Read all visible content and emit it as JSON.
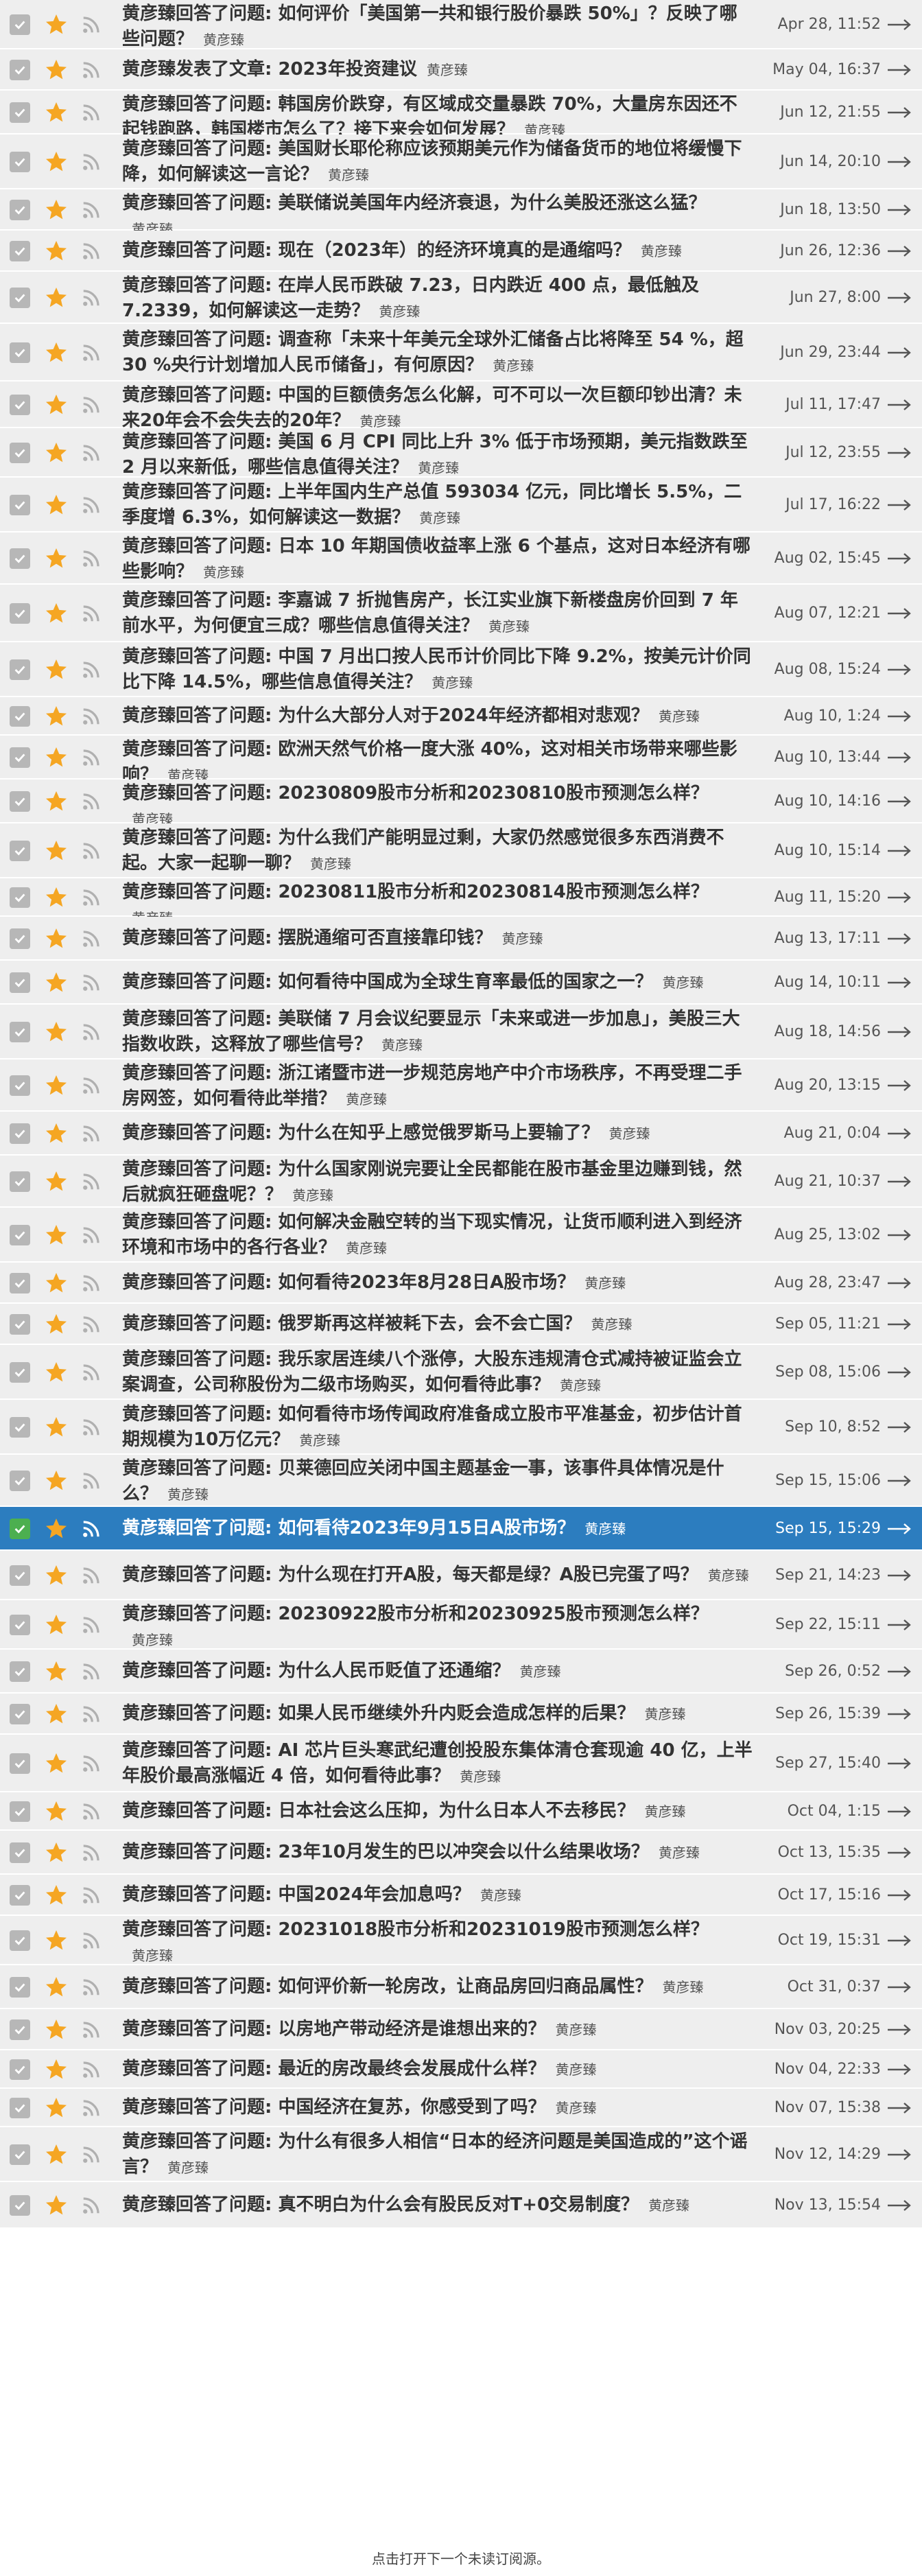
{
  "colors": {
    "row_bg": "#eeeeee",
    "selected_row_bg": "#2c7dbf",
    "star": "#f5a623",
    "checkbox": "#b7b7b7",
    "checkbox_selected": "#4caf50"
  },
  "icons": [
    "checkbox-checked-icon",
    "star-icon",
    "rss-feed-icon",
    "arrow-right-icon"
  ],
  "items": [
    {
      "title": "黄彦臻回答了问题: 如何评价「美国第一共和银行股价暴跌 50%」？反映了哪些问题？",
      "author": "黄彦臻",
      "date": "Apr 28, 11:52"
    },
    {
      "title": "黄彦臻发表了文章: 2023年投资建议",
      "author": "黄彦臻",
      "date": "May 04, 16:37"
    },
    {
      "title": "黄彦臻回答了问题: 韩国房价跌穿，有区域成交量暴跌 70%，大量房东因还不起钱跑路，韩国楼市怎么了？接下来会如何发展？",
      "author": "黄彦臻",
      "date": "Jun 12, 21:55"
    },
    {
      "title": "黄彦臻回答了问题: 美国财长耶伦称应该预期美元作为储备货币的地位将缓慢下降，如何解读这一言论？",
      "author": "黄彦臻",
      "date": "Jun 14, 20:10"
    },
    {
      "title": "黄彦臻回答了问题: 美联储说美国年内经济衰退，为什么美股还涨这么猛？",
      "author": "黄彦臻",
      "date": "Jun 18, 13:50"
    },
    {
      "title": "黄彦臻回答了问题: 现在（2023年）的经济环境真的是通缩吗？",
      "author": "黄彦臻",
      "date": "Jun 26, 12:36"
    },
    {
      "title": "黄彦臻回答了问题: 在岸人民币跌破 7.23，日内跌近 400 点，最低触及 7.2339，如何解读这一走势？",
      "author": "黄彦臻",
      "date": "Jun 27, 8:00"
    },
    {
      "title": "黄彦臻回答了问题: 调查称「未来十年美元全球外汇储备占比将降至 54 %，超 30 %央行计划增加人民币储备」，有何原因？",
      "author": "黄彦臻",
      "date": "Jun 29, 23:44"
    },
    {
      "title": "黄彦臻回答了问题: 中国的巨额债务怎么化解，可不可以一次巨额印钞出清？未来20年会不会失去的20年？",
      "author": "黄彦臻",
      "date": "Jul 11, 17:47"
    },
    {
      "title": "黄彦臻回答了问题: 美国 6 月 CPI 同比上升 3% 低于市场预期，美元指数跌至 2 月以来新低，哪些信息值得关注？",
      "author": "黄彦臻",
      "date": "Jul 12, 23:55"
    },
    {
      "title": "黄彦臻回答了问题: 上半年国内生产总值 593034 亿元，同比增长 5.5%，二季度增 6.3%，如何解读这一数据？",
      "author": "黄彦臻",
      "date": "Jul 17, 16:22"
    },
    {
      "title": "黄彦臻回答了问题: 日本 10 年期国债收益率上涨 6 个基点，这对日本经济有哪些影响？",
      "author": "黄彦臻",
      "date": "Aug 02, 15:45"
    },
    {
      "title": "黄彦臻回答了问题: 李嘉诚 7 折抛售房产，长江实业旗下新楼盘房价回到 7 年前水平，为何便宜三成？哪些信息值得关注？",
      "author": "黄彦臻",
      "date": "Aug 07, 12:21"
    },
    {
      "title": "黄彦臻回答了问题: 中国 7 月出口按人民币计价同比下降 9.2%，按美元计价同比下降 14.5%，哪些信息值得关注？",
      "author": "黄彦臻",
      "date": "Aug 08, 15:24"
    },
    {
      "title": "黄彦臻回答了问题: 为什么大部分人对于2024年经济都相对悲观？",
      "author": "黄彦臻",
      "date": "Aug 10, 1:24"
    },
    {
      "title": "黄彦臻回答了问题: 欧洲天然气价格一度大涨 40%，这对相关市场带来哪些影响？",
      "author": "黄彦臻",
      "date": "Aug 10, 13:44"
    },
    {
      "title": "黄彦臻回答了问题: 20230809股市分析和20230810股市预测怎么样？",
      "author": "黄彦臻",
      "date": "Aug 10, 14:16"
    },
    {
      "title": "黄彦臻回答了问题: 为什么我们产能明显过剩，大家仍然感觉很多东西消费不起。大家一起聊一聊？",
      "author": "黄彦臻",
      "date": "Aug 10, 15:14"
    },
    {
      "title": "黄彦臻回答了问题: 20230811股市分析和20230814股市预测怎么样？",
      "author": "黄彦臻",
      "date": "Aug 11, 15:20"
    },
    {
      "title": "黄彦臻回答了问题: 摆脱通缩可否直接靠印钱？",
      "author": "黄彦臻",
      "date": "Aug 13, 17:11"
    },
    {
      "title": "黄彦臻回答了问题: 如何看待中国成为全球生育率最低的国家之一？",
      "author": "黄彦臻",
      "date": "Aug 14, 10:11"
    },
    {
      "title": "黄彦臻回答了问题: 美联储 7 月会议纪要显示「未来或进一步加息」，美股三大指数收跌，这释放了哪些信号？",
      "author": "黄彦臻",
      "date": "Aug 18, 14:56"
    },
    {
      "title": "黄彦臻回答了问题: 浙江诸暨市进一步规范房地产中介市场秩序，不再受理二手房网签，如何看待此举措？",
      "author": "黄彦臻",
      "date": "Aug 20, 13:15"
    },
    {
      "title": "黄彦臻回答了问题: 为什么在知乎上感觉俄罗斯马上要输了？",
      "author": "黄彦臻",
      "date": "Aug 21, 0:04"
    },
    {
      "title": "黄彦臻回答了问题: 为什么国家刚说完要让全民都能在股市基金里边赚到钱，然后就疯狂砸盘呢？？",
      "author": "黄彦臻",
      "date": "Aug 21, 10:37"
    },
    {
      "title": "黄彦臻回答了问题: 如何解决金融空转的当下现实情况，让货币顺利进入到经济环境和市场中的各行各业？",
      "author": "黄彦臻",
      "date": "Aug 25, 13:02"
    },
    {
      "title": "黄彦臻回答了问题: 如何看待2023年8月28日A股市场？",
      "author": "黄彦臻",
      "date": "Aug 28, 23:47"
    },
    {
      "title": "黄彦臻回答了问题: 俄罗斯再这样被耗下去，会不会亡国？",
      "author": "黄彦臻",
      "date": "Sep 05, 11:21"
    },
    {
      "title": "黄彦臻回答了问题: 我乐家居连续八个涨停，大股东违规清仓式减持被证监会立案调查，公司称股份为二级市场购买，如何看待此事？",
      "author": "黄彦臻",
      "date": "Sep 08, 15:06"
    },
    {
      "title": "黄彦臻回答了问题: 如何看待市场传闻政府准备成立股市平准基金，初步估计首期规模为10万亿元？",
      "author": "黄彦臻",
      "date": "Sep 10, 8:52"
    },
    {
      "title": "黄彦臻回答了问题: 贝莱德回应关闭中国主题基金一事，该事件具体情况是什么？",
      "author": "黄彦臻",
      "date": "Sep 15, 15:06"
    },
    {
      "title": "黄彦臻回答了问题: 如何看待2023年9月15日A股市场？",
      "author": "黄彦臻",
      "date": "Sep 15, 15:29",
      "selected": true
    },
    {
      "title": "黄彦臻回答了问题: 为什么现在打开A股，每天都是绿？A股已完蛋了吗？",
      "author": "黄彦臻",
      "date": "Sep 21, 14:23"
    },
    {
      "title": "黄彦臻回答了问题: 20230922股市分析和20230925股市预测怎么样？",
      "author": "黄彦臻",
      "date": "Sep 22, 15:11"
    },
    {
      "title": "黄彦臻回答了问题: 为什么人民币贬值了还通缩？",
      "author": "黄彦臻",
      "date": "Sep 26, 0:52"
    },
    {
      "title": "黄彦臻回答了问题: 如果人民币继续外升内贬会造成怎样的后果？",
      "author": "黄彦臻",
      "date": "Sep 26, 15:39"
    },
    {
      "title": "黄彦臻回答了问题: AI 芯片巨头寒武纪遭创投股东集体清仓套现逾 40 亿，上半年股价最高涨幅近 4 倍，如何看待此事？",
      "author": "黄彦臻",
      "date": "Sep 27, 15:40"
    },
    {
      "title": "黄彦臻回答了问题: 日本社会这么压抑，为什么日本人不去移民？",
      "author": "黄彦臻",
      "date": "Oct 04, 1:15"
    },
    {
      "title": "黄彦臻回答了问题: 23年10月发生的巴以冲突会以什么结果收场？",
      "author": "黄彦臻",
      "date": "Oct 13, 15:35"
    },
    {
      "title": "黄彦臻回答了问题: 中国2024年会加息吗？",
      "author": "黄彦臻",
      "date": "Oct 17, 15:16"
    },
    {
      "title": "黄彦臻回答了问题: 20231018股市分析和20231019股市预测怎么样？",
      "author": "黄彦臻",
      "date": "Oct 19, 15:31"
    },
    {
      "title": "黄彦臻回答了问题: 如何评价新一轮房改，让商品房回归商品属性？",
      "author": "黄彦臻",
      "date": "Oct 31, 0:37"
    },
    {
      "title": "黄彦臻回答了问题: 以房地产带动经济是谁想出来的？",
      "author": "黄彦臻",
      "date": "Nov 03, 20:25"
    },
    {
      "title": "黄彦臻回答了问题: 最近的房改最终会发展成什么样？",
      "author": "黄彦臻",
      "date": "Nov 04, 22:33"
    },
    {
      "title": "黄彦臻回答了问题: 中国经济在复苏，你感受到了吗？",
      "author": "黄彦臻",
      "date": "Nov 07, 15:38"
    },
    {
      "title": "黄彦臻回答了问题: 为什么有很多人相信“日本的经济问题是美国造成的”这个谣言？",
      "author": "黄彦臻",
      "date": "Nov 12, 14:29"
    },
    {
      "title": "黄彦臻回答了问题: 真不明白为什么会有股民反对T+0交易制度？",
      "author": "黄彦臻",
      "date": "Nov 13, 15:54"
    }
  ],
  "footer": {
    "text": "点击打开下一个未读订阅源。"
  }
}
